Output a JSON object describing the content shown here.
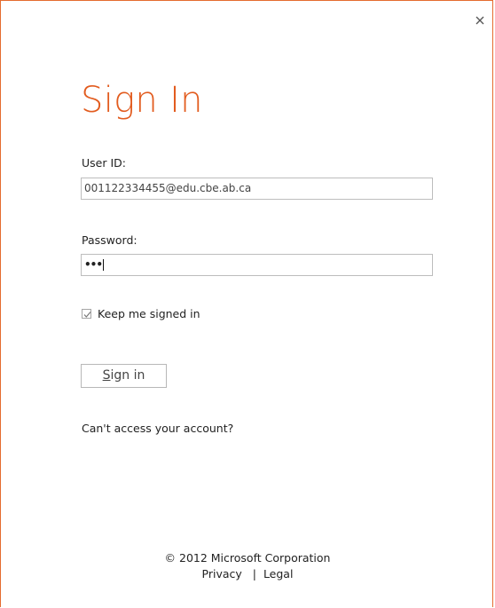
{
  "dialog": {
    "close_icon": "close-icon",
    "title": "Sign In",
    "accent_color": "#e25c1f"
  },
  "form": {
    "userid_label": "User ID:",
    "userid_value": "001122334455@edu.cbe.ab.ca",
    "password_label": "Password:",
    "password_masked": "•••",
    "keep_signed_in_label": "Keep me signed in",
    "keep_signed_in_checked": true,
    "signin_button_prefix": "S",
    "signin_button_rest": "ign in",
    "cant_access_link": "Can't access your account?"
  },
  "footer": {
    "copyright": "© 2012 Microsoft Corporation",
    "privacy": "Privacy",
    "separator": "|",
    "legal": "Legal"
  }
}
